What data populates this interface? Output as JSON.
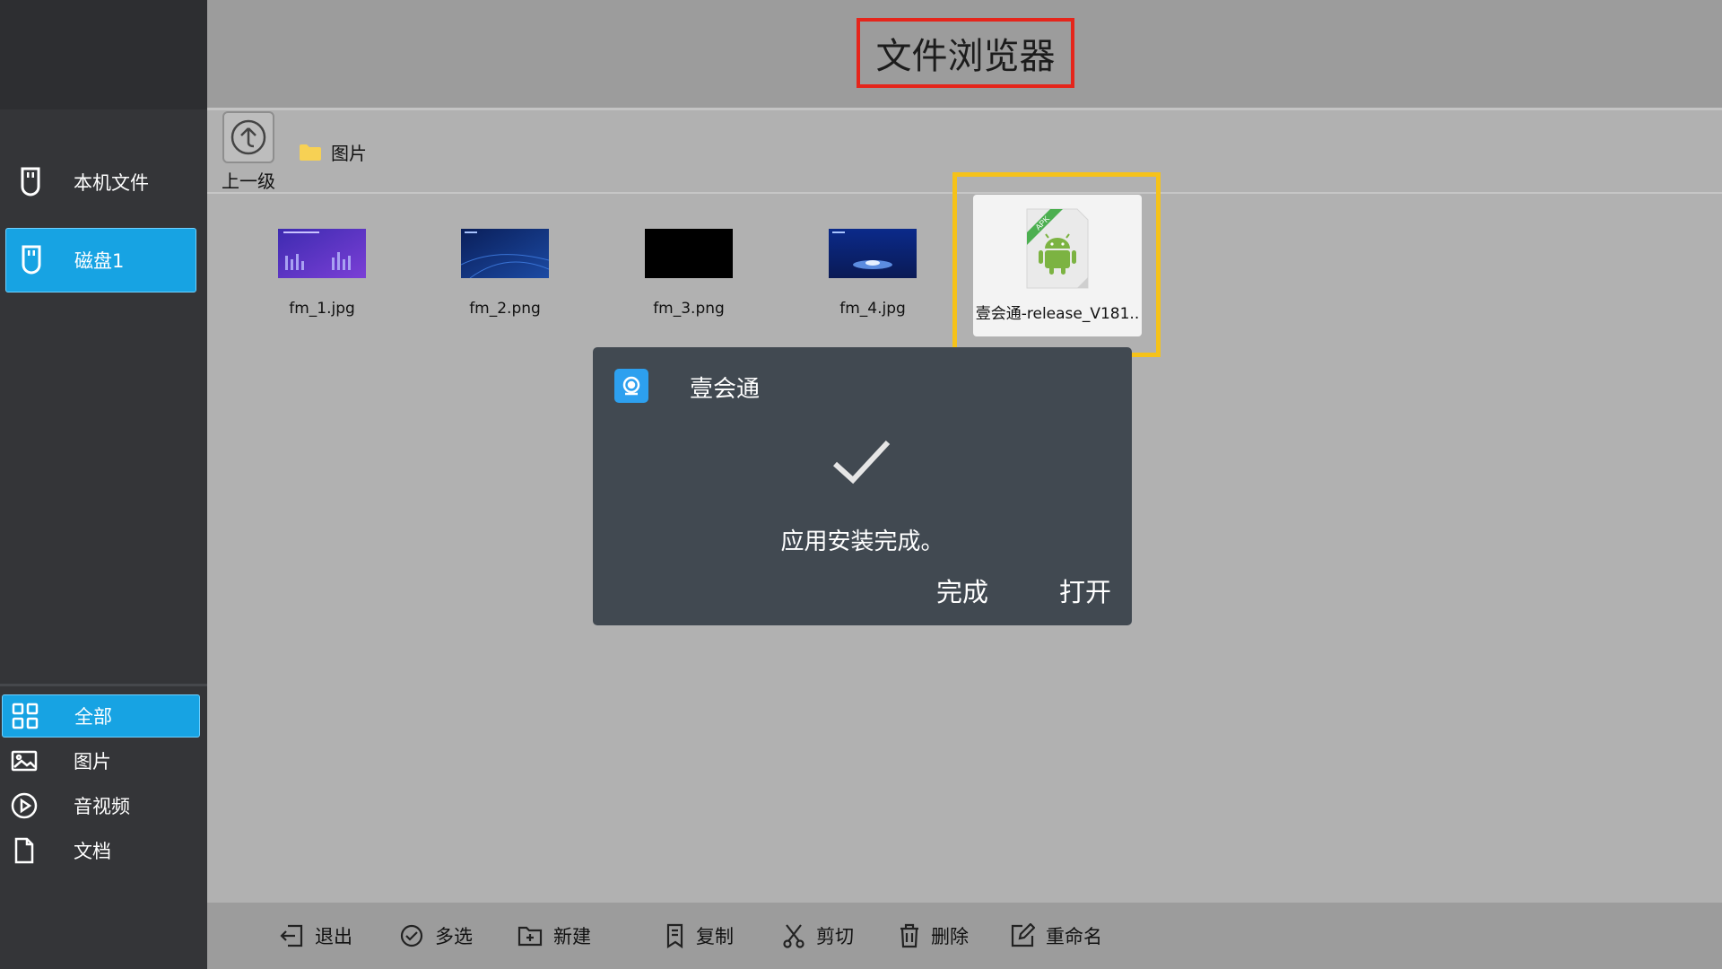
{
  "header": {
    "title": "文件浏览器"
  },
  "sidebar": {
    "storage": [
      {
        "label": "本机文件",
        "icon": "usb-drive-icon",
        "active": false
      },
      {
        "label": "磁盘1",
        "icon": "usb-drive-icon",
        "active": true
      }
    ],
    "categories": [
      {
        "label": "全部",
        "icon": "grid-icon",
        "active": true
      },
      {
        "label": "图片",
        "icon": "image-icon",
        "active": false
      },
      {
        "label": "音视频",
        "icon": "play-icon",
        "active": false
      },
      {
        "label": "文档",
        "icon": "document-icon",
        "active": false
      }
    ]
  },
  "pathbar": {
    "up_label": "上一级",
    "crumb": "图片"
  },
  "files": [
    {
      "name": "fm_1.jpg"
    },
    {
      "name": "fm_2.png"
    },
    {
      "name": "fm_3.png"
    },
    {
      "name": "fm_4.jpg"
    },
    {
      "name": "壹会通-release_V181..",
      "badge": "APK"
    }
  ],
  "dialog": {
    "app_name": "壹会通",
    "message": "应用安装完成。",
    "done_label": "完成",
    "open_label": "打开"
  },
  "toolbar": {
    "items": [
      {
        "label": "退出",
        "icon": "exit-icon"
      },
      {
        "label": "多选",
        "icon": "check-circle-icon"
      },
      {
        "label": "新建",
        "icon": "new-folder-icon"
      },
      {
        "label": "复制",
        "icon": "copy-icon"
      },
      {
        "label": "剪切",
        "icon": "scissors-icon"
      },
      {
        "label": "删除",
        "icon": "trash-icon"
      },
      {
        "label": "重命名",
        "icon": "edit-icon"
      }
    ]
  },
  "colors": {
    "accent": "#17a3e3",
    "title_highlight": "#e5251b",
    "file_highlight": "#f5c21a",
    "dialog_bg": "#414951",
    "sidebar_bg": "#343538"
  }
}
